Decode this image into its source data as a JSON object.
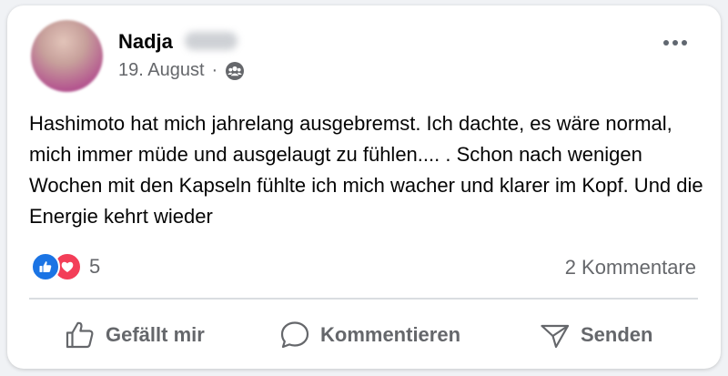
{
  "post": {
    "author": {
      "name": "Nadja"
    },
    "date": "19. August",
    "separator": "·",
    "privacy_icon": "friends-icon",
    "text": "Hashimoto hat mich jahrelang ausgebremst. Ich dachte, es wäre normal, mich immer müde und ausgelaugt zu fühlen.... . Schon nach wenigen Wochen mit den Kapseln fühlte ich mich wacher und klarer im Kopf. Und die Energie kehrt wieder"
  },
  "reactions": {
    "icons": [
      "like-reaction-icon",
      "love-reaction-icon"
    ],
    "count": "5",
    "comments": "2 Kommentare"
  },
  "actions": {
    "like_label": "Gefällt mir",
    "comment_label": "Kommentieren",
    "send_label": "Senden"
  },
  "colors": {
    "like_blue": "#1b74e4",
    "love_red": "#f33e58",
    "secondary_text": "#65676b",
    "primary_text": "#050505"
  }
}
